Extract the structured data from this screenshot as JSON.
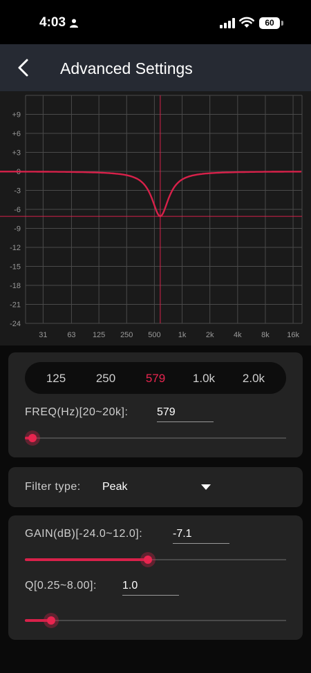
{
  "status_bar": {
    "time": "4:03",
    "battery": "60"
  },
  "header": {
    "title": "Advanced Settings"
  },
  "chart_data": {
    "type": "line",
    "y_ticks": [
      "+9",
      "+6",
      "+3",
      "0",
      "-3",
      "-6",
      "-9",
      "-12",
      "-15",
      "-18",
      "-21",
      "-24"
    ],
    "ylim": [
      -24,
      12
    ],
    "x_ticks": [
      "31",
      "63",
      "125",
      "250",
      "500",
      "1k",
      "2k",
      "4k",
      "8k",
      "16k"
    ],
    "x_tick_hz": [
      31,
      63,
      125,
      250,
      500,
      1000,
      2000,
      4000,
      8000,
      16000
    ],
    "xlim_hz": [
      20,
      20000
    ],
    "x_scale": "log",
    "grid": true,
    "series": [
      {
        "values_description_hz": [
          20,
          100,
          200,
          300,
          400,
          500,
          579,
          700,
          900,
          1200,
          2000,
          5000,
          20000
        ],
        "values": [
          0,
          -0.1,
          -0.6,
          -1.6,
          -3.4,
          -6.0,
          -7.1,
          -5.4,
          -2.9,
          -1.2,
          -0.3,
          0,
          0
        ]
      }
    ],
    "marker": {
      "freq_hz": 579,
      "gain_db": -7.1
    },
    "line_color": "#d8214a"
  },
  "presets": [
    "125",
    "250",
    "579",
    "1.0k",
    "2.0k"
  ],
  "active_preset": "579",
  "freq": {
    "label": "FREQ(Hz)[20~20k]:",
    "value": "579",
    "slider_fraction": 0.03
  },
  "filter": {
    "label": "Filter type:",
    "value": "Peak"
  },
  "gain": {
    "label": "GAIN(dB)[-24.0~12.0]:",
    "value": "-7.1",
    "slider_fraction": 0.47
  },
  "q": {
    "label": "Q[0.25~8.00]:",
    "value": "1.0",
    "slider_fraction": 0.1
  },
  "colors": {
    "accent": "#e8254f",
    "background": "#0a0a0a",
    "card": "#232323",
    "header": "#262a33"
  }
}
